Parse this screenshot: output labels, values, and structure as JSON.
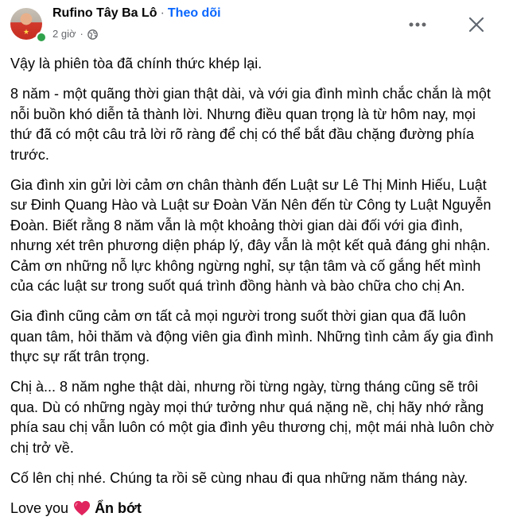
{
  "header": {
    "author": "Rufino Tây Ba Lô",
    "separator": "·",
    "follow_label": "Theo dõi",
    "time": "2 giờ",
    "meta_separator": "·",
    "privacy_icon": "globe-icon"
  },
  "actions": {
    "more_icon": "more-options-icon",
    "close_icon": "close-icon"
  },
  "post": {
    "paragraphs": [
      "Vậy là phiên tòa đã chính thức khép lại.",
      "8 năm - một quãng thời gian thật dài, và với gia đình mình chắc chắn là một nỗi buồn khó diễn tả thành lời. Nhưng điều quan trọng là từ hôm nay, mọi thứ đã có một câu trả lời rõ ràng để chị có thể bắt đầu chặng đường phía trước.",
      "Gia đình xin gửi lời cảm ơn chân thành đến Luật sư Lê Thị Minh Hiếu, Luật sư Đinh Quang Hào và Luật sư Đoàn Văn Nên đến từ Công ty Luật Nguyễn Đoàn. Biết rằng 8 năm vẫn là một khoảng thời gian dài đối với gia đình, nhưng xét trên phương diện pháp lý, đây vẫn là một kết quả đáng ghi nhận. Cảm ơn những nỗ lực không ngừng nghỉ, sự tận tâm và cố gắng hết mình của các luật sư trong suốt quá trình đồng hành và bào chữa cho chị An.",
      "Gia đình cũng cảm ơn tất cả mọi người trong suốt thời gian qua đã luôn quan tâm, hỏi thăm và động viên gia đình mình. Những tình cảm ấy gia đình thực sự rất trân trọng.",
      "Chị à... 8 năm nghe thật dài, nhưng rồi từng ngày, từng tháng cũng sẽ trôi qua. Dù có những ngày mọi thứ tưởng như quá nặng nề, chị hãy nhớ rằng phía sau chị vẫn luôn có một gia đình yêu thương chị, một mái nhà luôn chờ chị trở về.",
      "Cố lên chị nhé. Chúng ta rồi sẽ cùng nhau đi qua những năm tháng này."
    ],
    "closing_text": "Love you",
    "closing_emoji": "red-heart-icon",
    "show_less_label": "Ẩn bớt"
  },
  "colors": {
    "text": "#050505",
    "secondary": "#65676b",
    "link": "#0866ff",
    "online": "#31a24c",
    "heart": "#e0245e"
  }
}
